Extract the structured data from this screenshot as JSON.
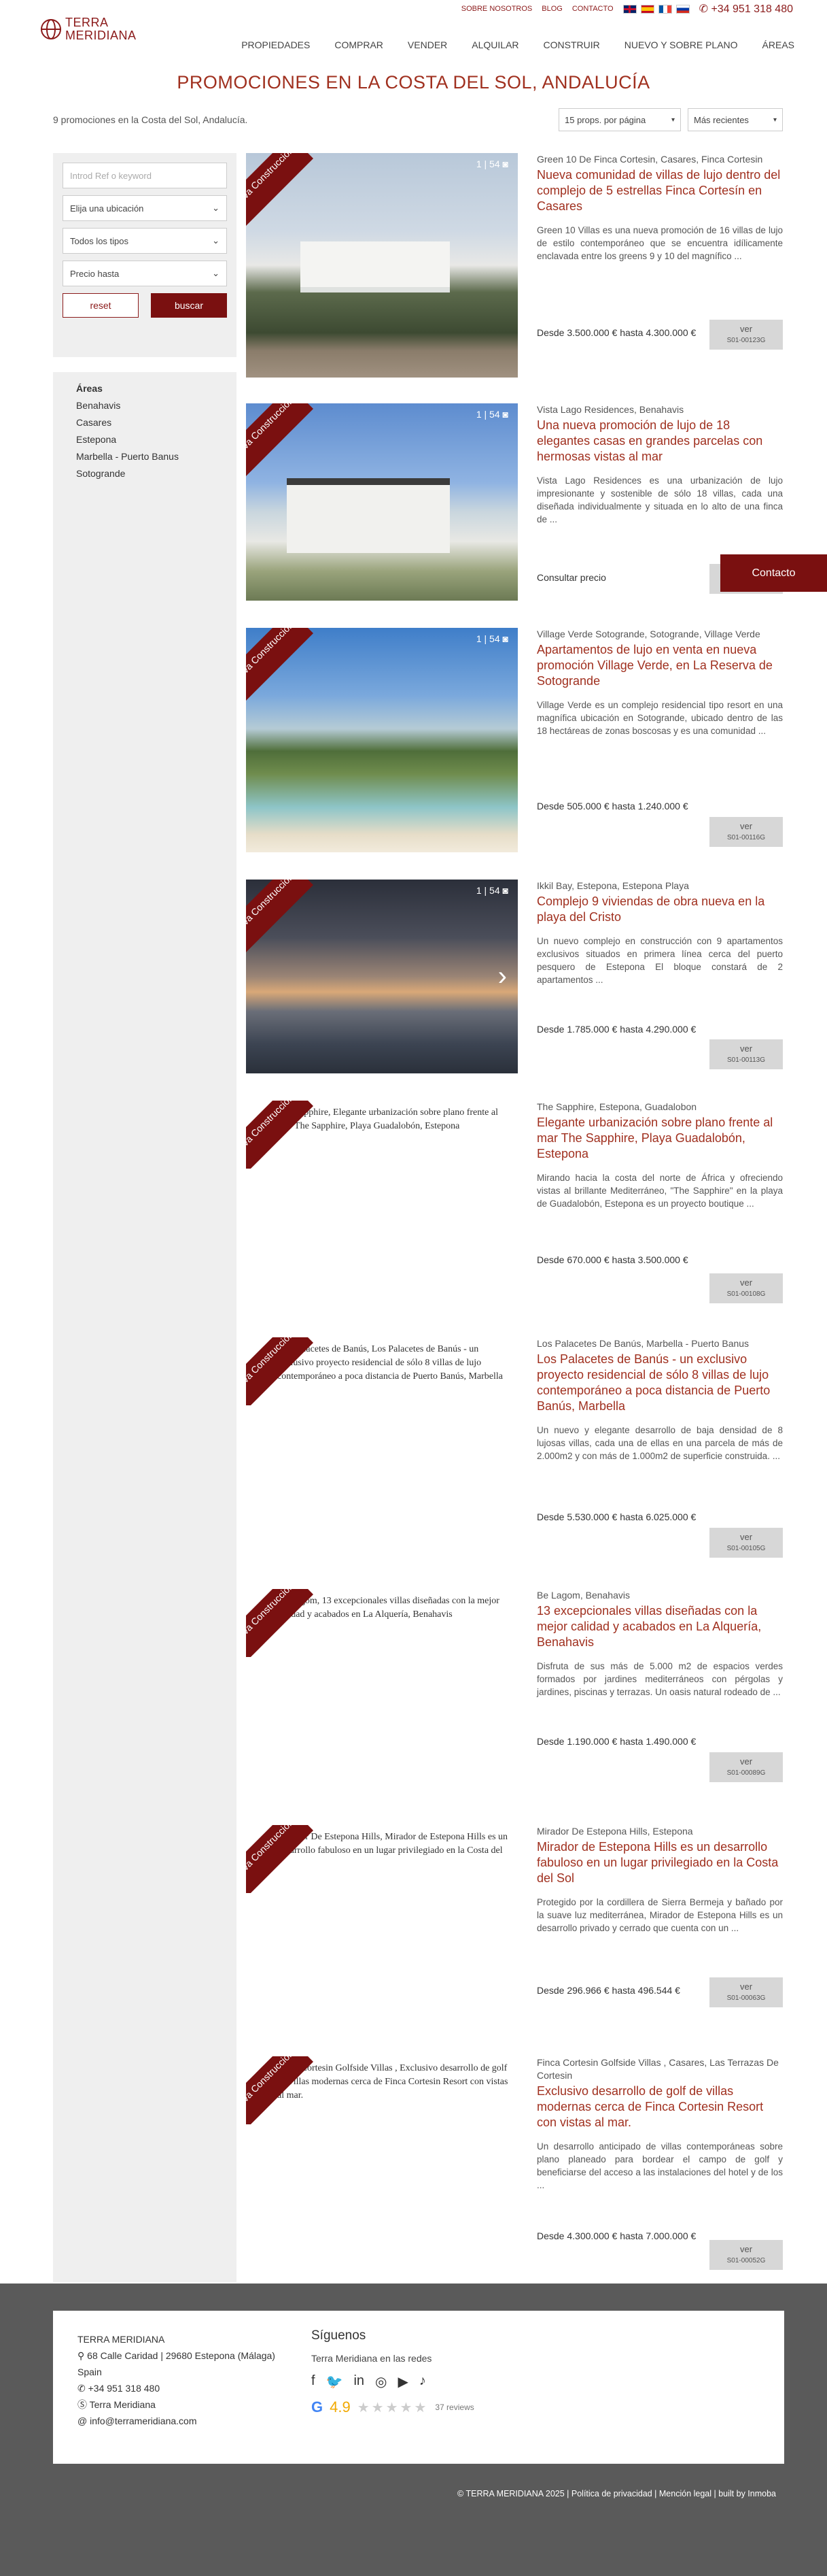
{
  "topbar": {
    "links": [
      "SOBRE NOSOTROS",
      "BLOG",
      "CONTACTO"
    ],
    "phone": "+34 951 318 480"
  },
  "logo": {
    "line1": "TERRA",
    "line2": "MERIDIANA"
  },
  "nav": [
    "PROPIEDADES",
    "COMPRAR",
    "VENDER",
    "ALQUILAR",
    "CONSTRUIR",
    "NUEVO Y SOBRE PLANO",
    "ÁREAS"
  ],
  "page_title": "PROMOCIONES EN LA COSTA DEL SOL, ANDALUCÍA",
  "results": {
    "count": "9 promociones en la Costa del Sol, Andalucía.",
    "per_page": "15 props. por página",
    "sort": "Más recientes"
  },
  "filters": {
    "ref_placeholder": "Introd Ref o keyword",
    "location": "Elija una ubicación",
    "types": "Todos los tipos",
    "price": "Precio hasta",
    "reset": "reset",
    "buscar": "buscar"
  },
  "areas": {
    "heading": "Áreas",
    "items": [
      "Benahavis",
      "Casares",
      "Estepona",
      "Marbella - Puerto Banus",
      "Sotogrande"
    ]
  },
  "ribbon": "Nueva Construcción",
  "contacto": "Contacto",
  "listings": [
    {
      "photo_count": "1 | 54",
      "loc": "Green 10 De Finca Cortesin, Casares, Finca Cortesin",
      "title": "Nueva comunidad de villas de lujo dentro del complejo de 5 estrellas Finca Cortesín en Casares",
      "desc": "Green 10 Villas es una nueva promoción de 16 villas de lujo de estilo contemporáneo que se encuentra idílicamente enclavada entre los greens 9 y 10 del magnífico ...",
      "price": "Desde 3.500.000 € hasta 4.300.000 €",
      "ver": "ver",
      "ref": "S01-00123G",
      "alt": ""
    },
    {
      "photo_count": "1 | 54",
      "loc": "Vista Lago Residences, Benahavis",
      "title": "Una nueva promoción de lujo de 18 elegantes casas en grandes parcelas con hermosas vistas al mar",
      "desc": "Vista Lago Residences es una urbanización de lujo impresionante y sostenible de sólo 18 villas, cada una diseñada individualmente y situada en lo alto de una finca de ...",
      "price": "Consultar precio",
      "ver": "ver",
      "ref": "",
      "alt": ""
    },
    {
      "photo_count": "1 | 54",
      "loc": "Village Verde Sotogrande, Sotogrande, Village Verde",
      "title": "Apartamentos de lujo en venta en nueva promoción Village Verde, en La Reserva de Sotogrande",
      "desc": "Village Verde es un complejo residencial tipo resort en una magnífica ubicación en Sotogrande, ubicado dentro de las 18 hectáreas de zonas boscosas y es una comunidad ...",
      "price": "Desde 505.000 € hasta 1.240.000 €",
      "ver": "ver",
      "ref": "S01-00116G",
      "alt": ""
    },
    {
      "photo_count": "1 | 54",
      "loc": "Ikkil Bay, Estepona, Estepona Playa",
      "title": "Complejo 9 viviendas de obra nueva en la playa del Cristo",
      "desc": "Un nuevo complejo en construcción con 9 apartamentos exclusivos situados en primera línea cerca del puerto pesquero de Estepona El bloque constará de 2 apartamentos ...",
      "price": "Desde 1.785.000 € hasta 4.290.000 €",
      "ver": "ver",
      "ref": "S01-00113G",
      "alt": ""
    },
    {
      "photo_count": "",
      "loc": "The Sapphire, Estepona, Guadalobon",
      "title": "Elegante urbanización sobre plano frente al mar The Sapphire, Playa Guadalobón, Estepona",
      "desc": "Mirando hacia la costa del norte de África y ofreciendo vistas al brillante Mediterráneo, \"The Sapphire\" en la playa de Guadalobón, Estepona es un proyecto boutique ...",
      "price": "Desde 670.000 € hasta 3.500.000 €",
      "ver": "ver",
      "ref": "S01-00108G",
      "alt": "The Sapphire, Elegante urbanización sobre plano frente al mar The Sapphire, Playa Guadalobón, Estepona"
    },
    {
      "photo_count": "",
      "loc": "Los Palacetes De Banús, Marbella - Puerto Banus",
      "title": "Los Palacetes de Banús - un exclusivo proyecto residencial de sólo 8 villas de lujo contemporáneo a poca distancia de Puerto Banús, Marbella",
      "desc": "Un nuevo y elegante desarrollo de baja densidad de 8 lujosas villas, cada una de ellas en una parcela de más de 2.000m2 y con más de 1.000m2 de superficie construida. ...",
      "price": "Desde 5.530.000 € hasta 6.025.000 €",
      "ver": "ver",
      "ref": "S01-00105G",
      "alt": "Los Palacetes de Banús, Los Palacetes de Banús - un exclusivo proyecto residencial de sólo 8 villas de lujo contemporáneo a poca distancia de Puerto Banús, Marbella"
    },
    {
      "photo_count": "",
      "loc": "Be Lagom, Benahavis",
      "title": "13 excepcionales villas diseñadas con la mejor calidad y acabados en La Alquería, Benahavis",
      "desc": "Disfruta de sus más de 5.000 m2 de espacios verdes formados por jardines mediterráneos con pérgolas y jardines, piscinas y terrazas. Un oasis natural rodeado de ...",
      "price": "Desde 1.190.000 € hasta 1.490.000 €",
      "ver": "ver",
      "ref": "S01-00089G",
      "alt": "Be Lagom, 13 excepcionales villas diseñadas con la mejor calidad y acabados en La Alquería, Benahavis"
    },
    {
      "photo_count": "",
      "loc": "Mirador De Estepona Hills, Estepona",
      "title": "Mirador de Estepona Hills es un desarrollo fabuloso en un lugar privilegiado en la Costa del Sol",
      "desc": "Protegido por la cordillera de Sierra Bermeja y bañado por la suave luz mediterránea, Mirador de Estepona Hills es un desarrollo privado y cerrado que cuenta con un ...",
      "price": "Desde 296.966 € hasta 496.544 €",
      "ver": "ver",
      "ref": "S01-00063G",
      "alt": "Mirador De Estepona Hills, Mirador de Estepona Hills es un desarrollo fabuloso en un lugar privilegiado en la Costa del Sol"
    },
    {
      "photo_count": "",
      "loc": "Finca Cortesin Golfside Villas , Casares, Las Terrazas De Cortesin",
      "title": "Exclusivo desarrollo de golf de villas modernas cerca de Finca Cortesin Resort con vistas al mar.",
      "desc": "Un desarrollo anticipado de villas contemporáneas sobre plano planeado para bordear el campo de golf y beneficiarse del acceso a las instalaciones del hotel y de los ...",
      "price": "Desde 4.300.000 € hasta 7.000.000 €",
      "ver": "ver",
      "ref": "S01-00052G",
      "alt": "Finca Cortesin Golfside Villas , Exclusivo desarrollo de golf de villas modernas cerca de Finca Cortesin Resort con vistas al mar."
    }
  ],
  "footer": {
    "company": "TERRA MERIDIANA",
    "address": "68 Calle Caridad | 29680 Estepona (Málaga) Spain",
    "phone": "+34 951 318 480",
    "skype": "Terra Meridiana",
    "email": "info@terrameridiana.com",
    "social_title": "Síguenos",
    "social_sub": "Terra Meridiana en las redes",
    "rating": "4.9",
    "reviews": "37 reviews",
    "copyright": "© TERRA MERIDIANA 2025 | Política de privacidad | Mención legal | built by Inmoba"
  }
}
